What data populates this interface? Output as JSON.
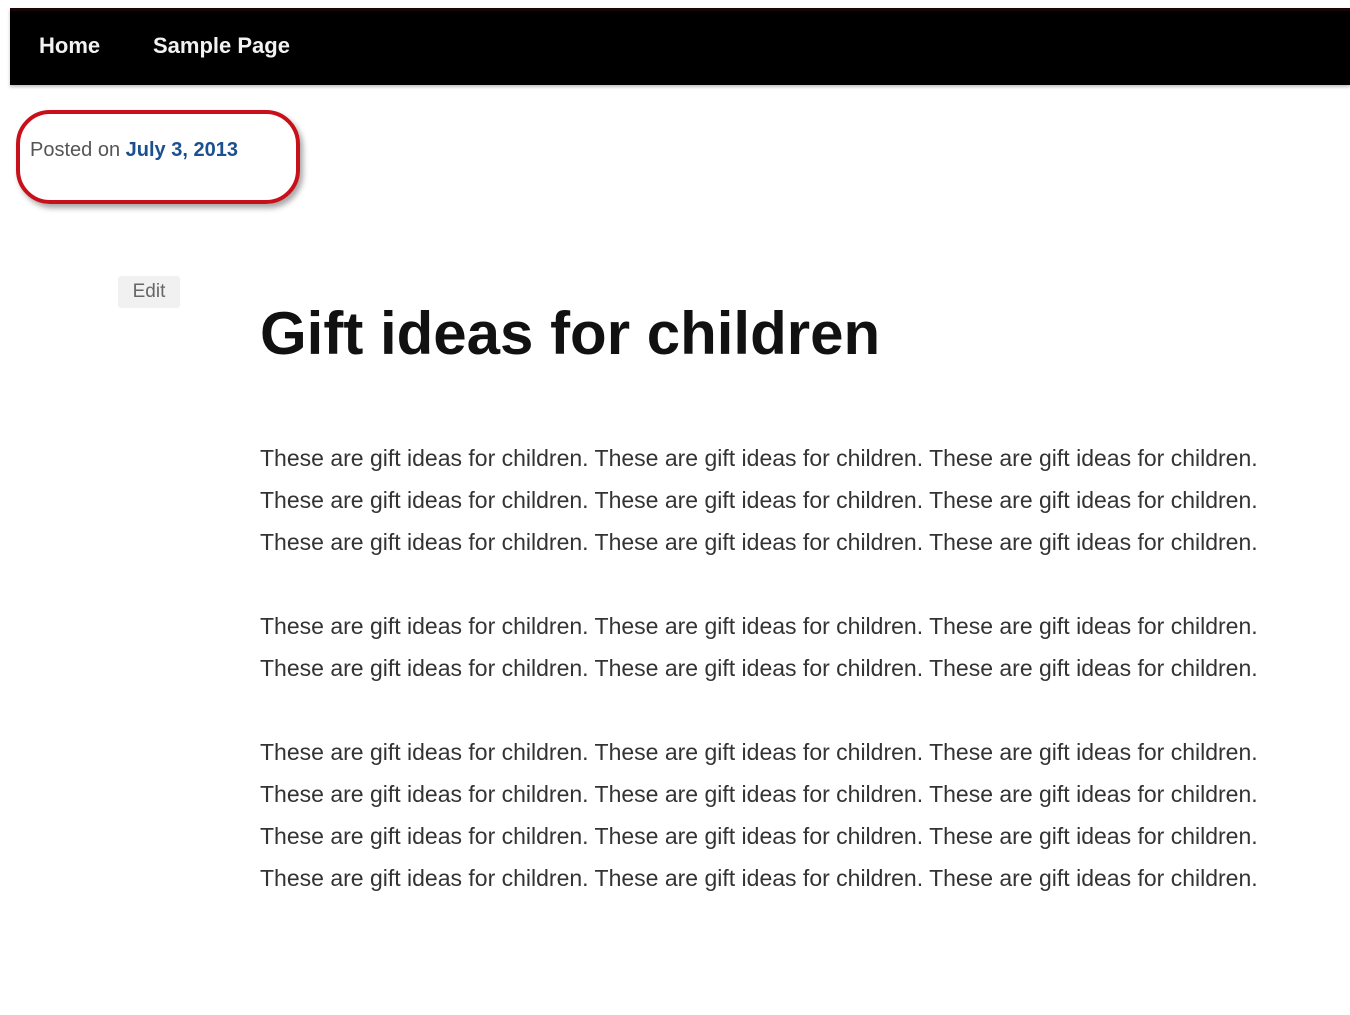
{
  "nav": {
    "items": [
      {
        "label": "Home"
      },
      {
        "label": "Sample Page"
      }
    ]
  },
  "post": {
    "meta_prefix": "Posted on",
    "date": "July 3, 2013",
    "edit_label": "Edit",
    "title": "Gift ideas for children",
    "paragraphs": [
      "These are gift ideas for children. These are gift ideas for children. These are gift ideas for children. These are gift ideas for children. These are gift ideas for children. These are gift ideas for children. These are gift ideas for children. These are gift ideas for children. These are gift ideas for children.",
      "These are gift ideas for children. These are gift ideas for children. These are gift ideas for children. These are gift ideas for children. These are gift ideas for children. These are gift ideas for children.",
      "These are gift ideas for children. These are gift ideas for children. These are gift ideas for children. These are gift ideas for children. These are gift ideas for children. These are gift ideas for children. These are gift ideas for children. These are gift ideas for children. These are gift ideas for children. These are gift ideas for children. These are gift ideas for children. These are gift ideas for children."
    ]
  },
  "colors": {
    "nav_background": "#000000",
    "date_link": "#1b4f8f",
    "highlight_ring": "#c8101a"
  }
}
